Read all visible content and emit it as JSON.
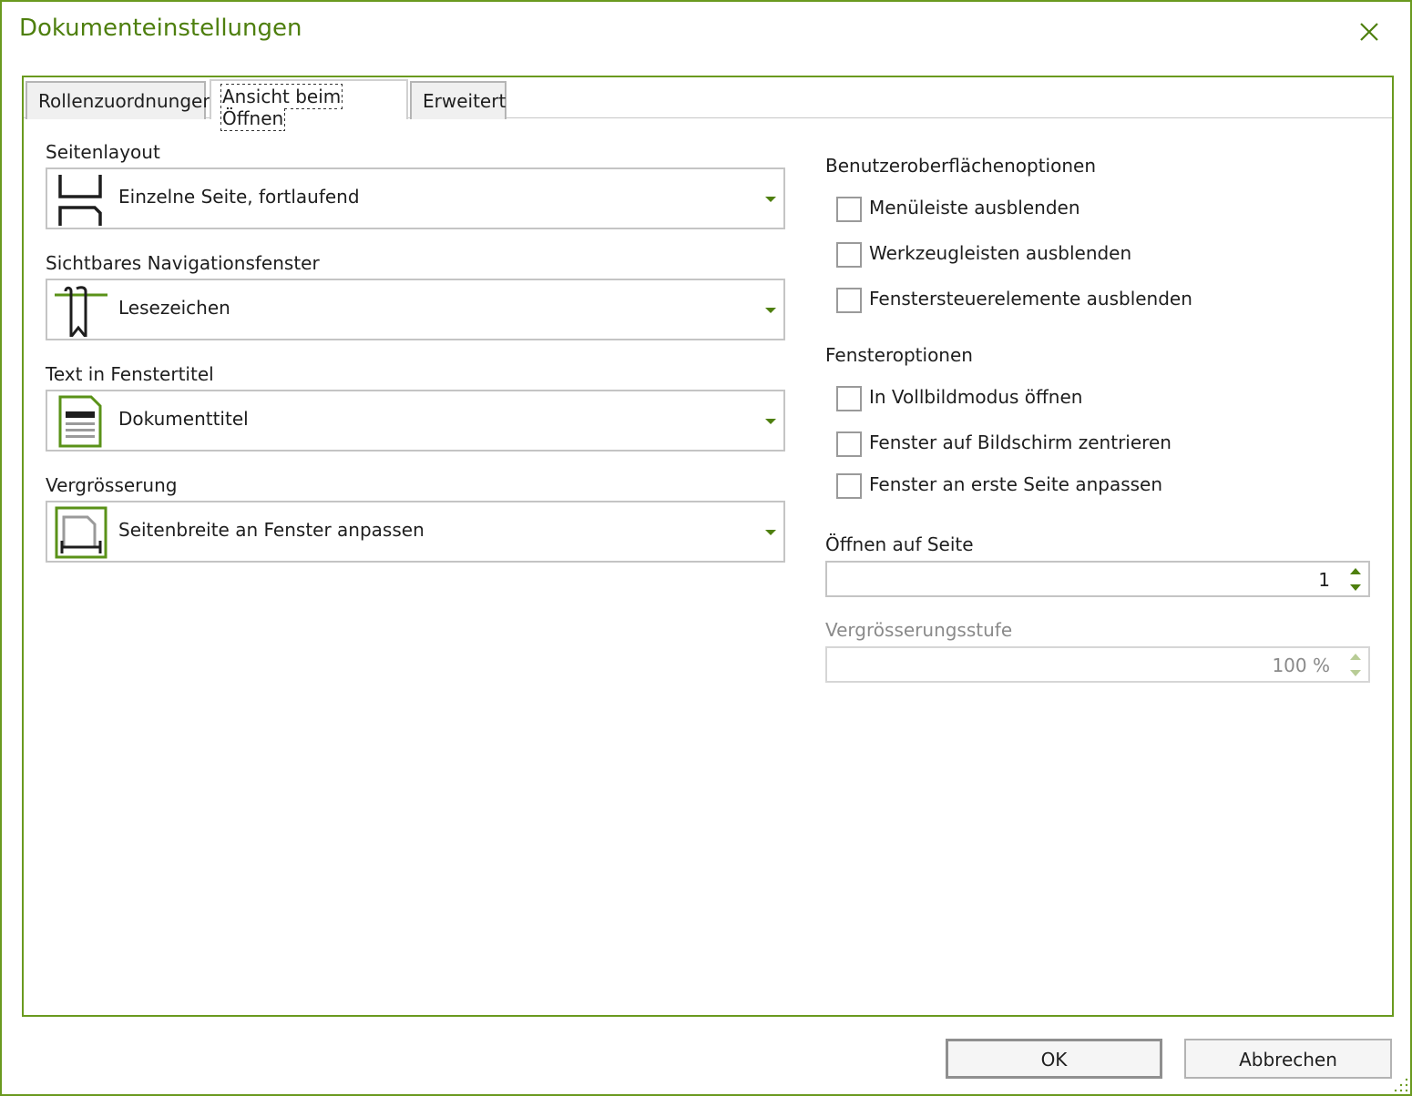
{
  "dialog": {
    "title": "Dokumenteinstellungen",
    "close_icon": "close-icon"
  },
  "tabs": [
    {
      "label": "Rollenzuordnungen",
      "active": false
    },
    {
      "label": "Ansicht beim Öffnen",
      "active": true
    },
    {
      "label": "Erweitert",
      "active": false
    }
  ],
  "left": {
    "page_layout": {
      "label": "Seitenlayout",
      "value": "Einzelne Seite, fortlaufend",
      "icon": "single-page-continuous-icon"
    },
    "navigation": {
      "label": "Sichtbares Navigationsfenster",
      "value": "Lesezeichen",
      "icon": "bookmark-icon"
    },
    "window_title": {
      "label": "Text in Fenstertitel",
      "value": "Dokumenttitel",
      "icon": "document-title-icon"
    },
    "magnification": {
      "label": "Vergrösserung",
      "value": "Seitenbreite an Fenster anpassen",
      "icon": "fit-width-icon"
    }
  },
  "right": {
    "ui_options": {
      "heading": "Benutzeroberflächenoptionen",
      "items": [
        {
          "label": "Menüleiste ausblenden",
          "checked": false
        },
        {
          "label": "Werkzeugleisten ausblenden",
          "checked": false
        },
        {
          "label": "Fenstersteuerelemente ausblenden",
          "checked": false
        }
      ]
    },
    "window_options": {
      "heading": "Fensteroptionen",
      "items": [
        {
          "label": "In Vollbildmodus öffnen",
          "checked": false
        },
        {
          "label": "Fenster auf Bildschirm zentrieren",
          "checked": false
        },
        {
          "label": "Fenster an erste Seite anpassen",
          "checked": false
        }
      ]
    },
    "open_page": {
      "label": "Öffnen auf Seite",
      "value": "1"
    },
    "zoom_level": {
      "label": "Vergrösserungsstufe",
      "value": "100 %",
      "disabled": true
    }
  },
  "buttons": {
    "ok": "OK",
    "cancel": "Abbrechen"
  },
  "colors": {
    "accent": "#6a9a1f",
    "title": "#4e7f0e"
  }
}
